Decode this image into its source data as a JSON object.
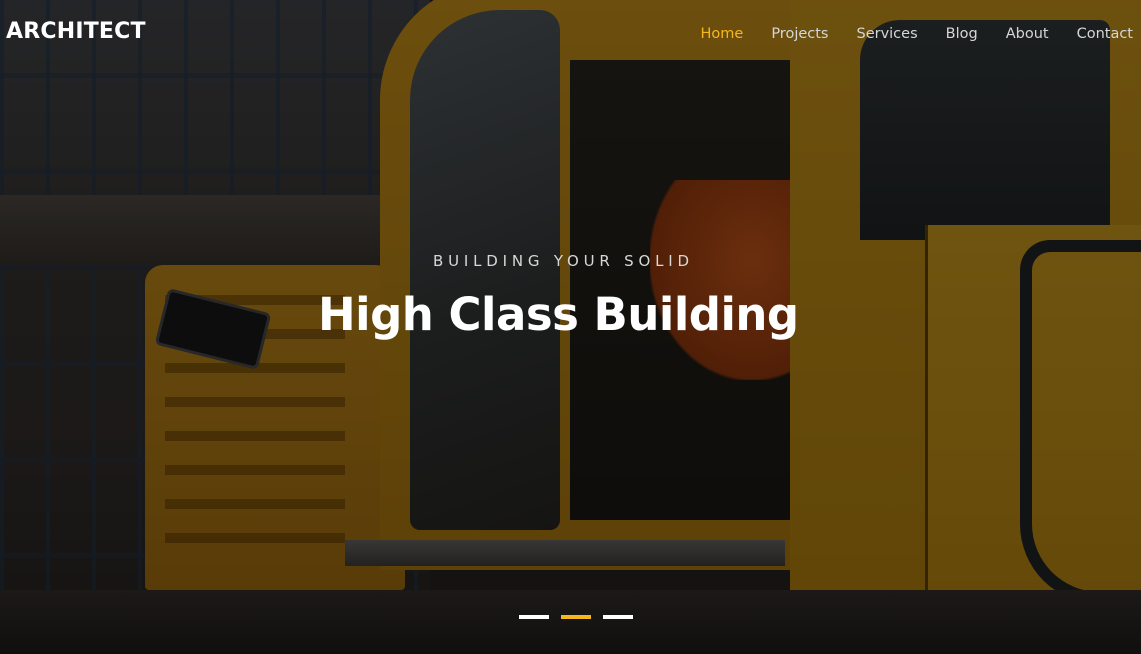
{
  "brand": {
    "name": "ARCHITECT"
  },
  "nav": {
    "items": [
      {
        "label": "Home",
        "active": true
      },
      {
        "label": "Projects",
        "active": false
      },
      {
        "label": "Services",
        "active": false
      },
      {
        "label": "Blog",
        "active": false
      },
      {
        "label": "About",
        "active": false
      },
      {
        "label": "Contact",
        "active": false
      }
    ]
  },
  "hero": {
    "eyebrow": "BUILDING YOUR SOLID",
    "headline": "High Class Building",
    "background_image": "construction-excavator-photo"
  },
  "slider": {
    "slide_count": 3,
    "active_index": 1
  },
  "colors": {
    "accent": "#f5b81c",
    "text_primary": "#ffffff",
    "nav_text": "#d6d6d6",
    "overlay": "rgba(0,0,0,0.52)"
  }
}
